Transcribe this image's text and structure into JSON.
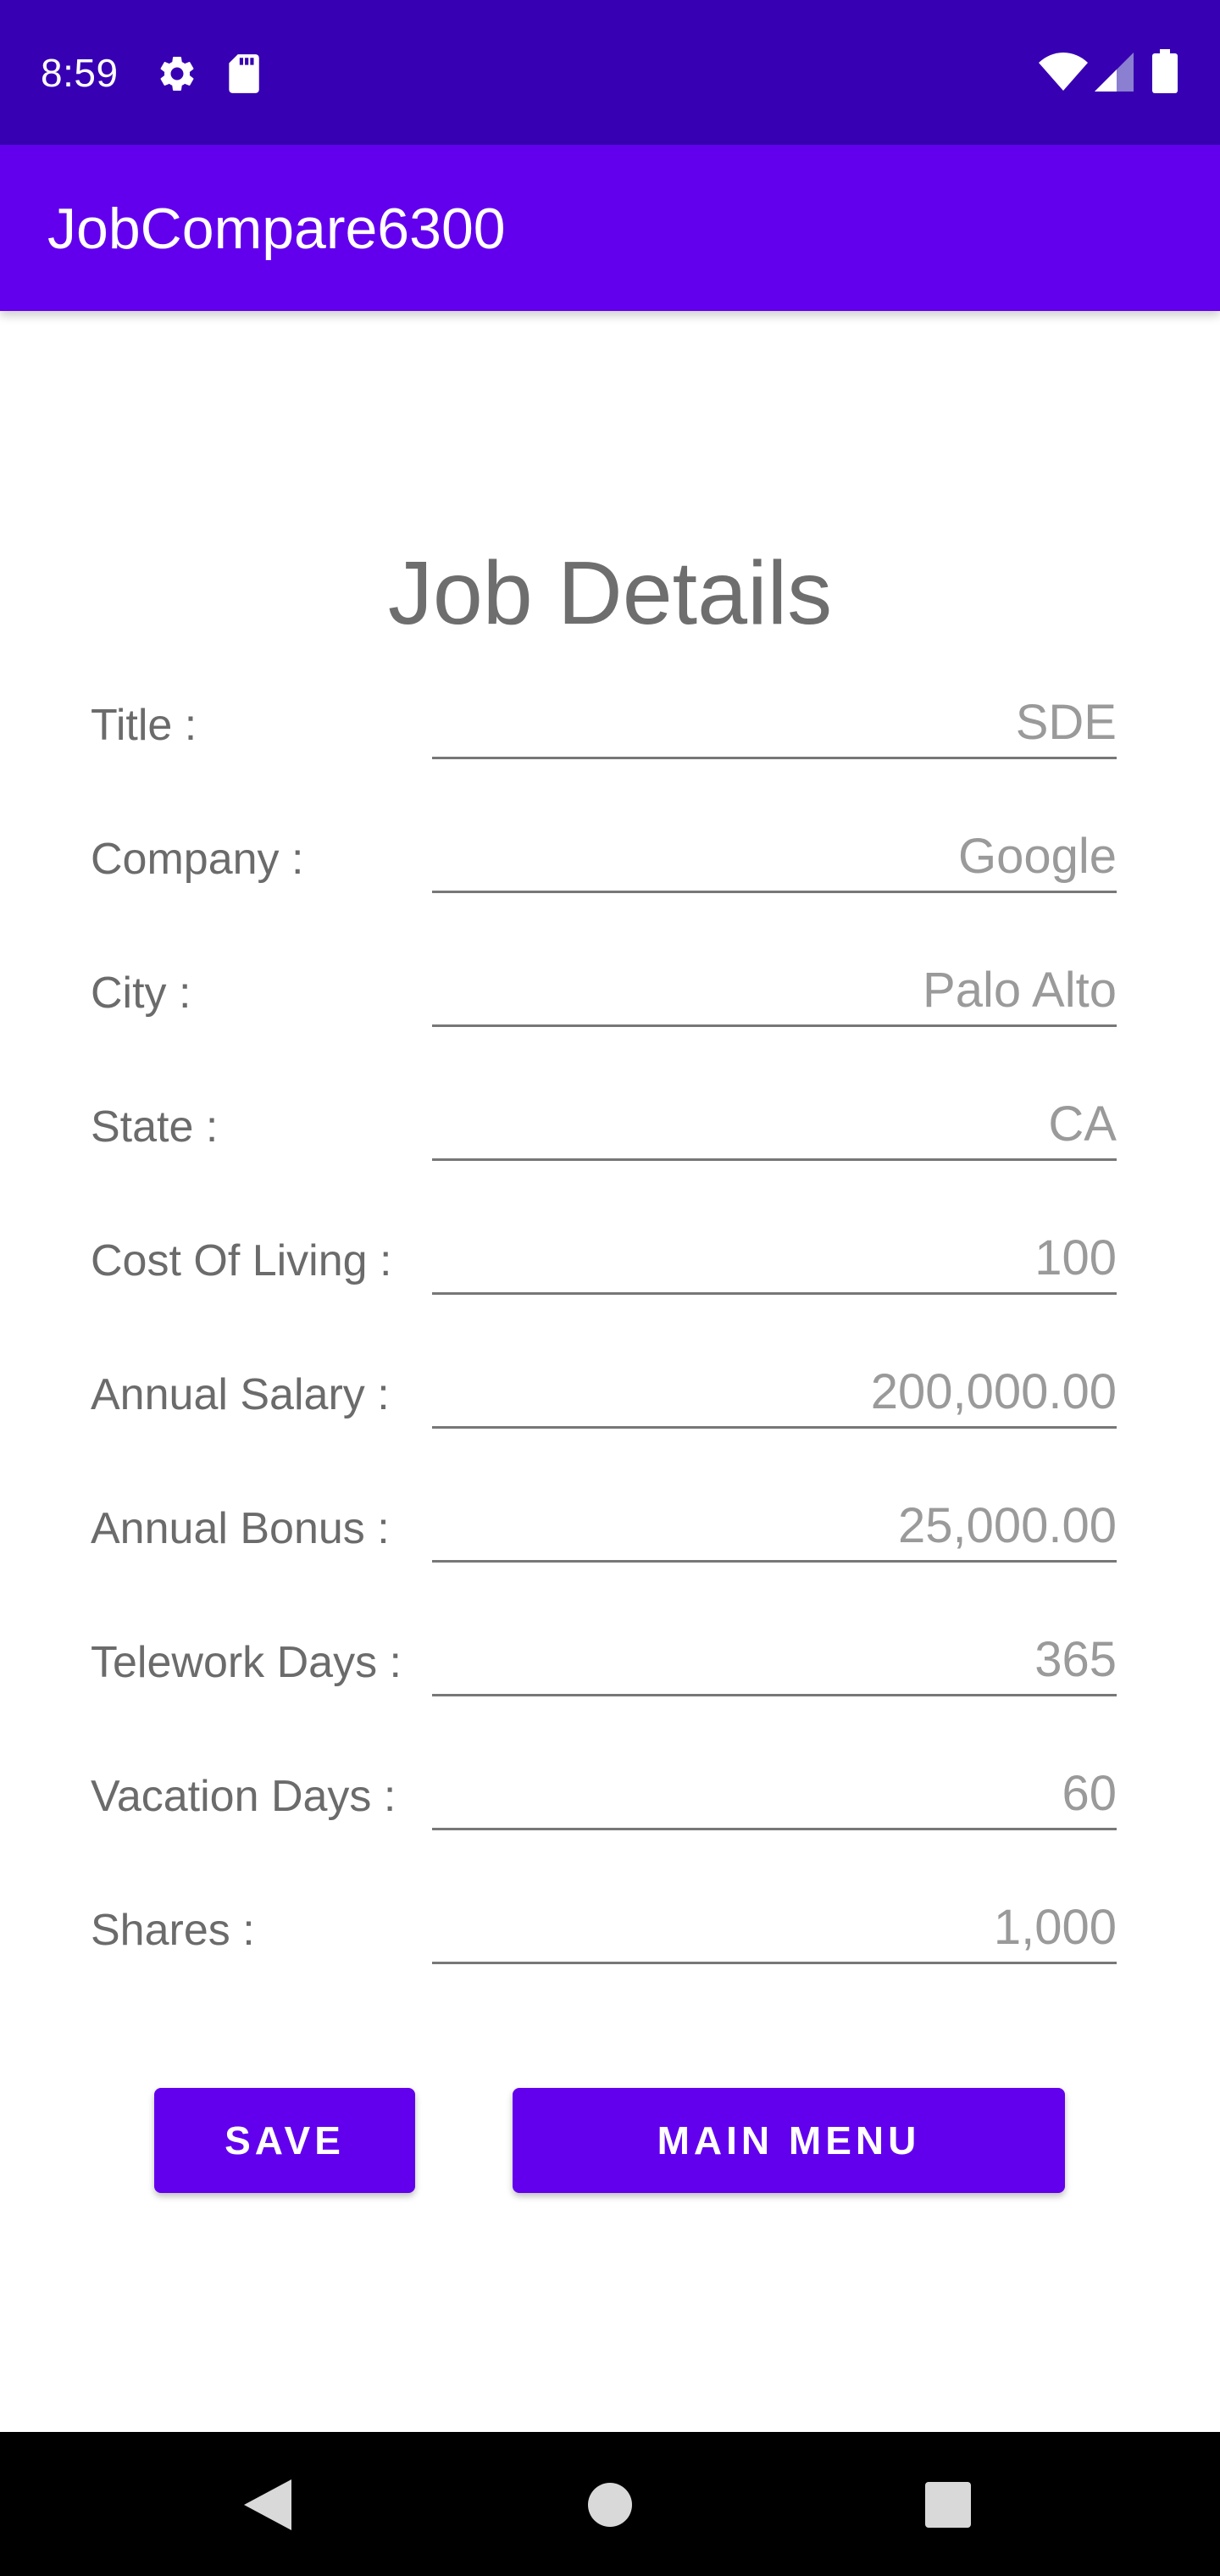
{
  "status_bar": {
    "time": "8:59",
    "icons": [
      "gear-icon",
      "sd-card-icon",
      "wifi-icon",
      "signal-icon",
      "battery-icon"
    ]
  },
  "app_bar": {
    "title": "JobCompare6300"
  },
  "page": {
    "title": "Job Details"
  },
  "form": {
    "fields": [
      {
        "label": "Title :",
        "placeholder": "SDE"
      },
      {
        "label": "Company :",
        "placeholder": "Google"
      },
      {
        "label": "City :",
        "placeholder": "Palo Alto"
      },
      {
        "label": "State :",
        "placeholder": "CA"
      },
      {
        "label": "Cost Of Living :",
        "placeholder": "100"
      },
      {
        "label": "Annual Salary :",
        "placeholder": "200,000.00"
      },
      {
        "label": "Annual Bonus :",
        "placeholder": "25,000.00"
      },
      {
        "label": "Telework Days :",
        "placeholder": "365"
      },
      {
        "label": "Vacation Days :",
        "placeholder": "60"
      },
      {
        "label": "Shares :",
        "placeholder": "1,000"
      }
    ]
  },
  "buttons": {
    "save": "SAVE",
    "main_menu": "MAIN MENU"
  },
  "colors": {
    "status_bar": "#3700b3",
    "app_bar": "#6200ee",
    "primary_button": "#6200ee"
  }
}
